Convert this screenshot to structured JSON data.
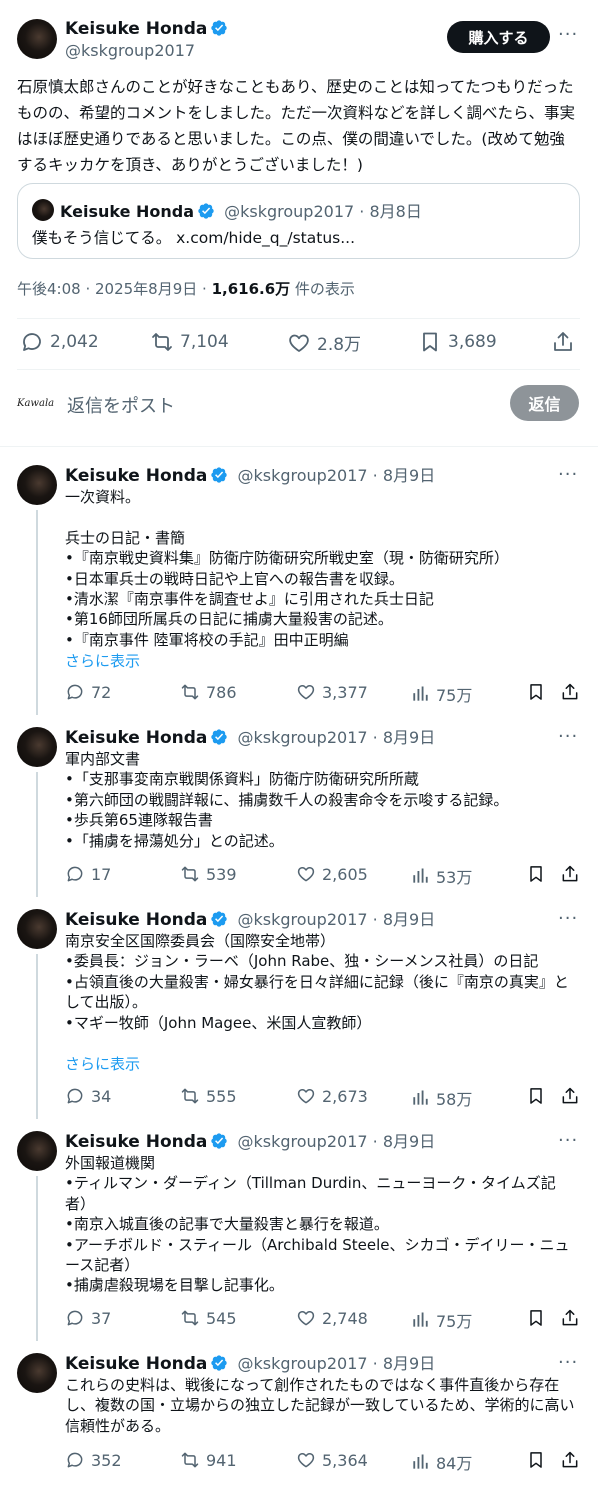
{
  "main": {
    "author": {
      "name": "Keisuke Honda",
      "handle": "@kskgroup2017"
    },
    "buy_button": "購入する",
    "text": "石原慎太郎さんのことが好きなこともあり、歴史のことは知ってたつもりだったものの、希望的コメントをしました。ただ一次資料などを詳しく調べたら、事実はほぼ歴史通りであると思いました。この点、僕の間違いでした。(改めて勉強するキッカケを頂き、ありがとうございました！)",
    "quote": {
      "name": "Keisuke Honda",
      "handle": "@kskgroup2017",
      "date": "· 8月8日",
      "text": "僕もそう信じてる。 x.com/hide_q_/status..."
    },
    "meta": {
      "time": "午後4:08 · 2025年8月9日 · ",
      "views": "1,616.6万",
      "views_label": " 件の表示"
    },
    "stats": {
      "replies": "2,042",
      "reposts": "7,104",
      "likes": "2.8万",
      "bookmarks": "3,689"
    }
  },
  "compose": {
    "placeholder": "返信をポスト",
    "button": "返信",
    "avatar_text": "Kawala"
  },
  "replies": [
    {
      "name": "Keisuke Honda",
      "handle": "@kskgroup2017",
      "date": "· 8月9日",
      "text": "一次資料。\n\n兵士の日記・書簡\n•『南京戦史資料集』防衛庁防衛研究所戦史室（現・防衛研究所）\n•日本軍兵士の戦時日記や上官への報告書を収録。\n•清水潔『南京事件を調査せよ』に引用された兵士日記\n•第16師団所属兵の日記に捕虜大量殺害の記述。\n•『南京事件 陸軍将校の手記』田中正明編",
      "more": "さらに表示",
      "replies": "72",
      "reposts": "786",
      "likes": "3,377",
      "views": "75万"
    },
    {
      "name": "Keisuke Honda",
      "handle": "@kskgroup2017",
      "date": "· 8月9日",
      "text": "軍内部文書\n•「支那事変南京戦関係資料」防衛庁防衛研究所所蔵\n•第六師団の戦闘詳報に、捕虜数千人の殺害命令を示唆する記録。\n•歩兵第65連隊報告書\n•「捕虜を掃蕩処分」との記述。",
      "more": "",
      "replies": "17",
      "reposts": "539",
      "likes": "2,605",
      "views": "53万"
    },
    {
      "name": "Keisuke Honda",
      "handle": "@kskgroup2017",
      "date": "· 8月9日",
      "text": "南京安全区国際委員会（国際安全地帯）\n•委員長：ジョン・ラーベ（John Rabe、独・シーメンス社員）の日記\n•占領直後の大量殺害・婦女暴行を日々詳細に記録（後に『南京の真実』として出版）。\n•マギー牧師（John Magee、米国人宣教師）",
      "more": "さらに表示",
      "replies": "34",
      "reposts": "555",
      "likes": "2,673",
      "views": "58万"
    },
    {
      "name": "Keisuke Honda",
      "handle": "@kskgroup2017",
      "date": "· 8月9日",
      "text": "外国報道機関\n•ティルマン・ダーディン（Tillman Durdin、ニューヨーク・タイムズ記者）\n•南京入城直後の記事で大量殺害と暴行を報道。\n•アーチボルド・スティール（Archibald Steele、シカゴ・デイリー・ニュース記者）\n•捕虜虐殺現場を目撃し記事化。",
      "more": "",
      "replies": "37",
      "reposts": "545",
      "likes": "2,748",
      "views": "75万"
    },
    {
      "name": "Keisuke Honda",
      "handle": "@kskgroup2017",
      "date": "· 8月9日",
      "text": "これらの史料は、戦後になって創作されたものではなく事件直後から存在し、複数の国・立場からの独立した記録が一致しているため、学術的に高い信頼性がある。",
      "more": "",
      "replies": "352",
      "reposts": "941",
      "likes": "5,364",
      "views": "84万"
    }
  ]
}
